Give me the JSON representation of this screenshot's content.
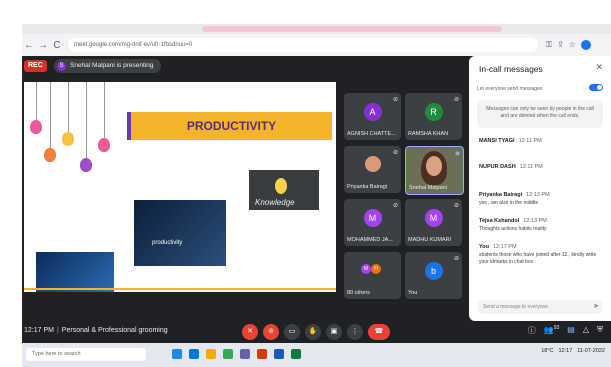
{
  "browser": {
    "back": "←",
    "forward": "→",
    "reload": "C",
    "url": "meet.google.com/mg-dnif-ev/ufr-1fbsdnuu=0",
    "icons": [
      "key-icon",
      "share-icon",
      "star-icon",
      "profile-icon"
    ]
  },
  "meet": {
    "rec_label": "REC",
    "presenter_initial": "S",
    "presenting_text": "Snehal Malpani is presenting"
  },
  "slide": {
    "title": "PRODUCTIVITY",
    "knowledge_caption": "Knowledge",
    "productivity_caption": "productivity"
  },
  "participants": [
    {
      "initial": "A",
      "name": "AGNISH CHATTE...",
      "color": "#8430ce"
    },
    {
      "initial": "R",
      "name": "RAMSHA KHAN",
      "color": "#1e8e3e"
    },
    {
      "initial": "",
      "name": "Priyanka Bairagi",
      "color": "#d99a7c"
    },
    {
      "initial": "",
      "name": "Snehal Malpani",
      "color": "#6b6f55"
    },
    {
      "initial": "M",
      "name": "MOHAMMED JA...",
      "color": "#a142f4"
    },
    {
      "initial": "M",
      "name": "MADHU KUMARI",
      "color": "#a142f4"
    },
    {
      "initial": "",
      "name": "80 others",
      "color": "#3c4043"
    },
    {
      "initial": "b",
      "name": "You",
      "color": "#1a73e8"
    }
  ],
  "others_avatars": [
    "M",
    "H"
  ],
  "panel": {
    "title": "In-call messages",
    "close": "✕",
    "toggle_label": "Let everyone send messages",
    "notice": "Messages can only be seen by people in the call and are deleted when the call ends.",
    "messages": [
      {
        "sender": "MANSI TYAGI",
        "time": "12:11 PM",
        "text": ""
      },
      {
        "sender": "NUPUR DASH",
        "time": "12:11 PM",
        "text": ""
      },
      {
        "sender": "Priyanka Bairagi",
        "time": "12:13 PM",
        "text": "yes , am also in the middle"
      },
      {
        "sender": "Tejsa Kshandol",
        "time": "12:13 PM",
        "text": "Thoughts actions habits reality"
      },
      {
        "sender": "You",
        "time": "12:17 PM",
        "text": "students those who have joined after 12 , kindly write your idmarks in chat box"
      }
    ],
    "send_placeholder": "Send a message to everyone",
    "send_icon": "➤"
  },
  "bottom": {
    "time": "12:17 PM",
    "separator": "|",
    "meeting_name": "Personal & Professional grooming",
    "controls": [
      "mic-off-icon",
      "camera-off-icon",
      "captions-icon",
      "raise-hand-icon",
      "present-icon",
      "more-icon",
      "end-call-icon"
    ],
    "right_controls": [
      "info-icon",
      "people-icon",
      "chat-icon",
      "activities-icon",
      "shield-icon"
    ],
    "people_count": "93"
  },
  "taskbar": {
    "search_placeholder": "Type here to search",
    "tray_weather": "18°C",
    "tray_time": "12:17",
    "tray_date": "11-07-2022"
  }
}
